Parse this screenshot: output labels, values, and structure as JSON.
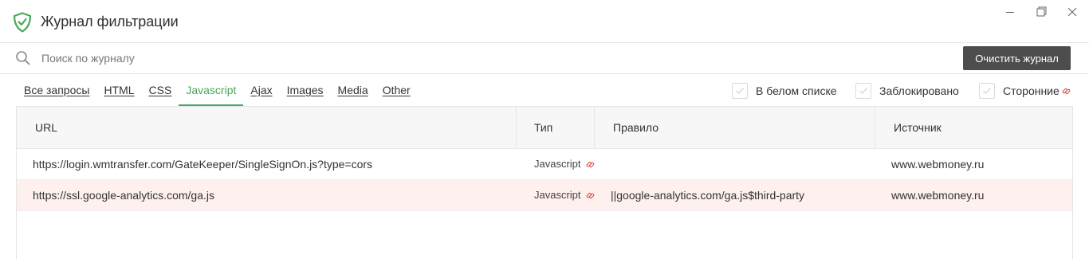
{
  "window": {
    "title": "Журнал фильтрации",
    "controls": [
      "minimize-icon",
      "restore-icon",
      "close-icon"
    ]
  },
  "search": {
    "placeholder": "Поиск по журналу",
    "value": "",
    "clear_button": "Очистить журнал"
  },
  "tabs": [
    {
      "label": "Все запросы",
      "active": false
    },
    {
      "label": "HTML",
      "active": false
    },
    {
      "label": "CSS",
      "active": false
    },
    {
      "label": "Javascript",
      "active": true
    },
    {
      "label": "Ajax",
      "active": false
    },
    {
      "label": "Images",
      "active": false
    },
    {
      "label": "Media",
      "active": false
    },
    {
      "label": "Other",
      "active": false
    }
  ],
  "filters": [
    {
      "label": "В белом списке",
      "checked": true
    },
    {
      "label": "Заблокировано",
      "checked": true
    },
    {
      "label": "Сторонние",
      "checked": true,
      "icon": "link-icon"
    }
  ],
  "table": {
    "columns": [
      "URL",
      "Тип",
      "Правило",
      "Источник"
    ],
    "rows": [
      {
        "url": "https://login.wmtransfer.com/GateKeeper/SingleSignOn.js?type=cors",
        "type": "Javascript",
        "rule": "",
        "source": "www.webmoney.ru",
        "blocked": false
      },
      {
        "url": "https://ssl.google-analytics.com/ga.js",
        "type": "Javascript",
        "rule": "||google-analytics.com/ga.js$third-party",
        "source": "www.webmoney.ru",
        "blocked": true
      }
    ]
  },
  "colors": {
    "accent": "#4aa85a",
    "blocked_row": "#fdf0ee",
    "third_party_link": "#e0473a",
    "button_bg": "#4d4d4d"
  }
}
